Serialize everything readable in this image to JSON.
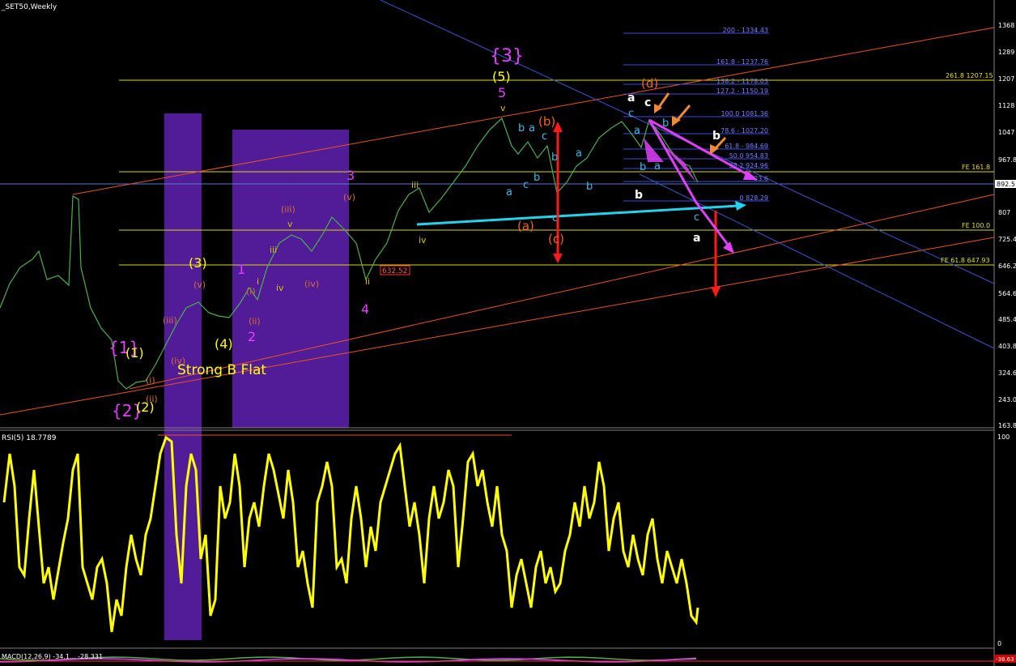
{
  "window": {
    "title": "_SET50,Weekly"
  },
  "indicators": {
    "rsi_label": "RSI(5) 18.7789",
    "rsi_max": "100",
    "rsi_min": "0",
    "macd_label": "MACD(12,26,9) -34.1... -28.331",
    "macd_value_tag": "-38.63"
  },
  "price_axis": {
    "ticks": [
      "1368",
      "1289",
      "1207",
      "1128",
      "1047",
      "967.8",
      "892.5",
      "807",
      "725.4",
      "646.2",
      "564.6",
      "485.4",
      "403.8",
      "324.6",
      "243.0",
      "163.8"
    ]
  },
  "levels": {
    "fe_161": "FE 161.8",
    "fe_100": "FE 100.0",
    "fe_61": "FE 61.8 647.93",
    "ext_261": "261.8 1207.15",
    "price_tag": "632.52",
    "current_price": "892.5"
  },
  "fibo": [
    {
      "label": "200 - 1334.43"
    },
    {
      "label": "161.8 - 1237.76"
    },
    {
      "label": "138.2 - 1178.03"
    },
    {
      "label": "127.2 - 1150.19"
    },
    {
      "label": "100.0 1081.36"
    },
    {
      "label": "78.6 - 1027.20"
    },
    {
      "label": "61.8 - 984.69"
    },
    {
      "label": "50.0 954.83"
    },
    {
      "label": "38.2 924.96"
    },
    {
      "label": "23.6"
    },
    {
      "label": "0 828.29"
    }
  ],
  "annotations": {
    "strong_b_flat": "Strong B Flat"
  },
  "waves": {
    "w1_big": "{1}",
    "w2_big": "{2}",
    "w3_big": "{3}",
    "p1": "(1)",
    "p2": "(2)",
    "p3": "(3)",
    "p4": "(4)",
    "p5": "(5)",
    "m1": "1",
    "m2": "2",
    "m3": "3",
    "m4": "4",
    "m5": "5",
    "oa": "(a)",
    "ob": "(b)",
    "oc": "(c)",
    "od": "(d)",
    "ri_i": "(i)",
    "ri_ii": "(ii)",
    "ri_iii": "(iii)",
    "ri_iv": "(iv)",
    "ri_v": "(v)",
    "ri_iii2": "(iii)",
    "ri_iv2": "(iv)",
    "ri_v2": "(v)",
    "ri_v3": "(v)",
    "ri_ii2": "(ii)",
    "ri_i2": "(i)",
    "sm_iii": "iii",
    "sm_iv": "iv",
    "sm_v": "v",
    "sm_iii2": "iii",
    "sm_iv2": "iv",
    "sm_v_top": "v",
    "sm_ii": "ii",
    "sm_i": "i",
    "c_a1": "a",
    "c_b1": "b",
    "c_c1": "c",
    "c_a2": "a",
    "c_b2": "b",
    "c_c2": "c",
    "c_a3": "a",
    "c_b3": "b",
    "c_c3": "c",
    "c_a4": "a",
    "c_b4": "b",
    "c_c4": "c",
    "c_a5": "a",
    "w_a": "a",
    "w_b": "b",
    "w_c": "c",
    "w_b2": "b",
    "w_a2": "a"
  },
  "chart_data": {
    "type": "line",
    "title": "_SET50,Weekly",
    "price_scale": [
      163.8,
      1368
    ],
    "series": [
      {
        "name": "RSI(5)",
        "last": 18.7789
      }
    ],
    "fe_levels": [
      {
        "label": "FE 161.8"
      },
      {
        "label": "FE 100.0"
      },
      {
        "label": "FE 61.8 647.93",
        "value": 647.93
      },
      {
        "label": "261.8 1207.15",
        "value": 1207.15
      }
    ]
  },
  "colors": {
    "price": "#4caf50",
    "rsi": "#ffff00",
    "purple_box": "#5b1fa8",
    "channel_orange": "#e8551e",
    "channel_blue": "#3a55c8",
    "cyan_arrow": "#22d3ee",
    "magenta": "#e040fb",
    "red_arrow": "#ff1a1a",
    "yellow_line": "#d8d800"
  }
}
